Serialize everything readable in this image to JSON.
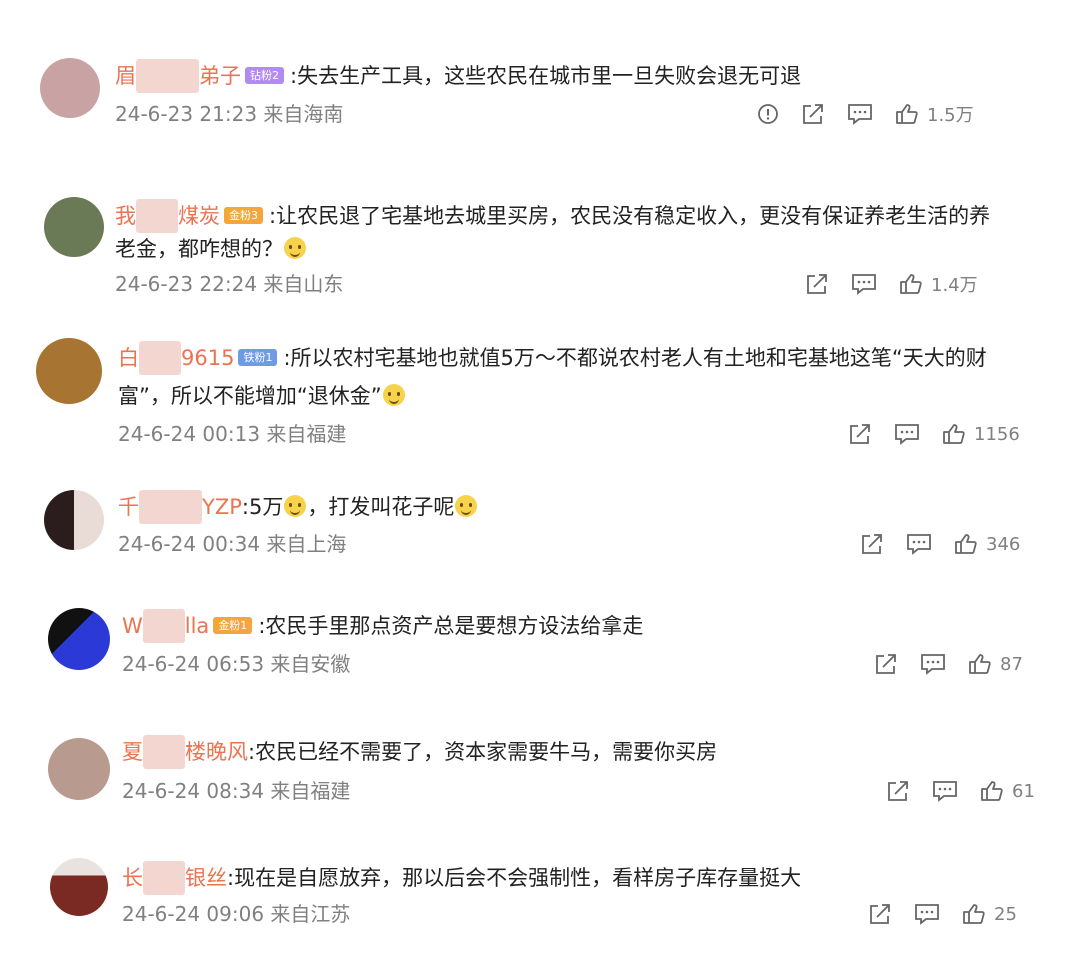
{
  "comments": [
    {
      "user_visible_start": "眉",
      "user_visible_end": "弟子",
      "badge": "钻粉2",
      "badge_type": "diamond",
      "text_line1": ":失去生产工具，这些农民在城市里一旦失败会退无可退",
      "text_line2": "",
      "date": "24-6-23 21:23",
      "location": "来自海南",
      "likes": "1.5万",
      "has_report": true,
      "emoji_line1": false,
      "emoji_line2": false,
      "avatar_color": "#c9a3a3"
    },
    {
      "user_visible_start": "我",
      "user_visible_end": "煤炭",
      "badge": "金粉3",
      "badge_type": "gold",
      "text_line1": "让农民退了宅基地去城里买房，农民没有稳定收入，更没有保证养老生活的养",
      "text_line2": "老金，都咋想的？",
      "date": "24-6-23 22:24",
      "location": "来自山东",
      "likes": "1.4万",
      "has_report": false,
      "emoji_line2": true,
      "avatar_color": "#6b7a56"
    },
    {
      "user_visible_start": "白",
      "user_visible_end": "9615",
      "badge": "铁粉1",
      "badge_type": "iron",
      "text_line1": ":所以农村宅基地也就值5万～不都说农村老人有土地和宅基地这笔“天大的财",
      "text_line2": "富”，所以不能增加“退休金”",
      "date": "24-6-24 00:13",
      "location": "来自福建",
      "likes": "1156",
      "has_report": false,
      "emoji_line2": true,
      "avatar_color": "#a87432"
    },
    {
      "user_visible_start": "千",
      "user_visible_end": "YZP",
      "badge": "",
      "badge_type": "",
      "text_line1": ":5万",
      "text_line1_after": "，打发叫花子呢",
      "text_line2": "",
      "date": "24-6-24 00:34",
      "location": "来自上海",
      "likes": "346",
      "has_report": false,
      "avatar_color": "#2b1d1d"
    },
    {
      "user_visible_start": "W",
      "user_visible_end": "lla",
      "badge": "金粉1",
      "badge_type": "gold",
      "text_line1": ":农民手里那点资产总是要想方设法给拿走",
      "text_line2": "",
      "date": "24-6-24 06:53",
      "location": "来自安徽",
      "likes": "87",
      "has_report": false,
      "avatar_color": "#2b3ad6"
    },
    {
      "user_visible_start": "夏",
      "user_visible_end": "楼晚风",
      "badge": "",
      "badge_type": "",
      "text_line1": ":农民已经不需要了，资本家需要牛马，需要你买房",
      "text_line2": "",
      "date": "24-6-24 08:34",
      "location": "来自福建",
      "likes": "61",
      "has_report": false,
      "avatar_color": "#b89a8e"
    },
    {
      "user_visible_start": "长",
      "user_visible_end": "银丝",
      "badge": "",
      "badge_type": "",
      "text_line1": ":现在是自愿放弃，那以后会不会强制性，看样房子库存量挺大",
      "text_line2": "",
      "date": "24-6-24 09:06",
      "location": "来自江苏",
      "likes": "25",
      "has_report": false,
      "avatar_color": "#7a2a22"
    }
  ],
  "icons": {
    "report": "report-icon",
    "share": "share-icon",
    "comment": "comment-icon",
    "like": "like-icon"
  },
  "colors": {
    "username": "#eb7350",
    "meta": "#808080",
    "text": "#222222"
  }
}
